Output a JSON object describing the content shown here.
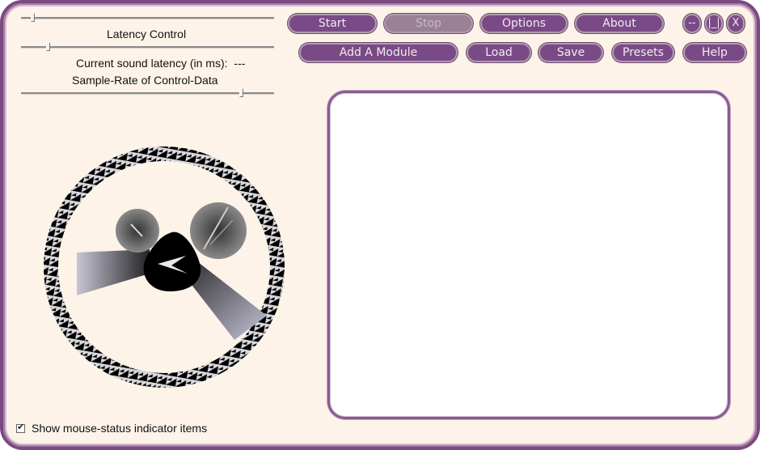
{
  "window": {
    "controls": {
      "minimize_label": "--",
      "restore_label": "|_|",
      "close_label": "X"
    }
  },
  "toolbar": {
    "row1": [
      {
        "label": "Start",
        "enabled": true
      },
      {
        "label": "Stop",
        "enabled": false
      },
      {
        "label": "Options",
        "enabled": true
      },
      {
        "label": "About",
        "enabled": true
      }
    ],
    "row2": [
      {
        "label": "Add A Module",
        "enabled": true
      },
      {
        "label": "Load",
        "enabled": true
      },
      {
        "label": "Save",
        "enabled": true
      },
      {
        "label": "Presets",
        "enabled": true
      },
      {
        "label": "Help",
        "enabled": true
      }
    ]
  },
  "left_panel": {
    "top_slider_value": 0.04,
    "latency_control_label": "Latency Control",
    "latency_slider_value": 0.1,
    "current_latency_label": "Current sound latency (in ms):",
    "current_latency_value": "---",
    "sample_rate_label": "Sample-Rate of Control-Data",
    "sample_rate_slider_value": 0.87
  },
  "checkbox": {
    "label": "Show mouse-status indicator items",
    "checked": true,
    "mark": "✔"
  },
  "colors": {
    "accent": "#7a4a86",
    "background": "#fdf3e8",
    "frame": "#7a4a7e",
    "disabled_button": "#9a8196"
  }
}
